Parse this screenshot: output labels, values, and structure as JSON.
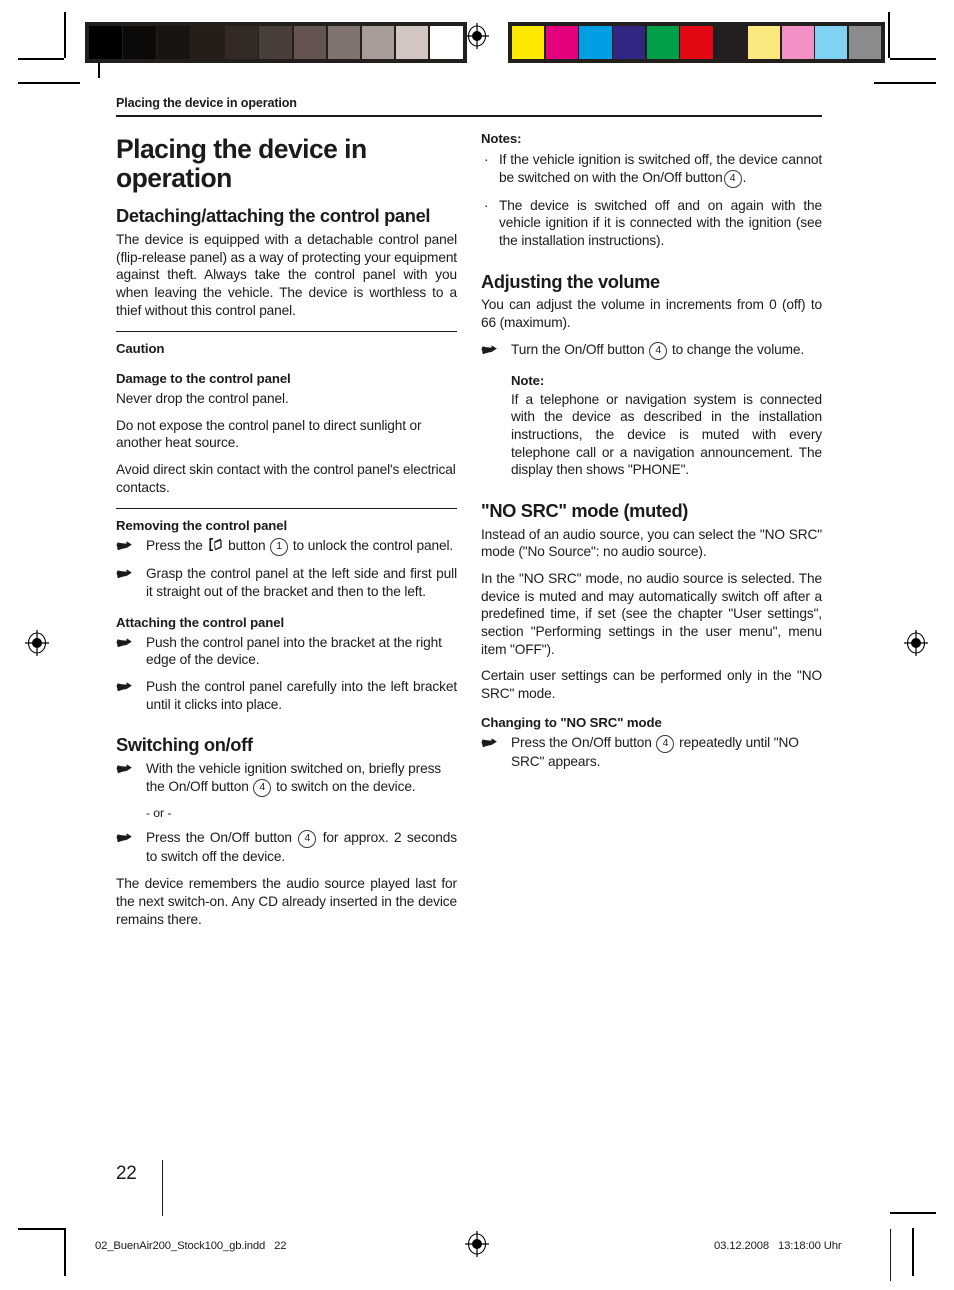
{
  "page": {
    "running_head": "Placing the device in operation",
    "page_number": "22"
  },
  "prepress": {
    "gray_bar_name": "grayscale-calibration-bar",
    "color_bar_name": "color-calibration-bar",
    "gray_swatches": [
      "#000000",
      "#0c0a08",
      "#19140f",
      "#241d18",
      "#332925",
      "#4a3e3a",
      "#635450",
      "#81736e",
      "#a89c98",
      "#d1c6c2",
      "#ffffff"
    ],
    "color_swatches": [
      "#fde900",
      "#e5007d",
      "#009ee3",
      "#312783",
      "#00a04b",
      "#e30613",
      "#231f20",
      "#fbe87f",
      "#f28fc4",
      "#7fd2f2",
      "#8d8c8c"
    ]
  },
  "main": {
    "title": "Placing the device in operation",
    "left": {
      "s1_heading": "Detaching/attaching the control panel",
      "s1_p1": "The device is equipped with a detachable control panel (flip-release panel) as a way of protecting your equipment against theft. Always take the control panel with you when leaving the vehicle. The device is worthless to a thief without this control panel.",
      "caution_heading": "Caution",
      "caution_sub": "Damage to the control panel",
      "caution_p1": "Never drop the control panel.",
      "caution_p2": "Do not expose the control panel to direct sunlight or another heat source.",
      "caution_p3": "Avoid direct skin contact with the control panel's electrical contacts.",
      "removing_heading": "Removing the control panel",
      "removing_item1_a": "Press the",
      "removing_item1_b": "button",
      "removing_item1_num": "1",
      "removing_item1_c": "to unlock the control panel.",
      "removing_item2": "Grasp the control panel at the left side and first pull it straight out of the bracket and then to the left.",
      "attaching_heading": "Attaching the control panel",
      "attaching_item1": "Push the control panel into the bracket at the right edge of the device.",
      "attaching_item2": "Push the control panel carefully into the left bracket until it clicks into place.",
      "switching_heading": "Switching on/off",
      "switching_item1_a": "With the vehicle ignition switched on, briefly press the On/Off button",
      "switching_item1_num": "4",
      "switching_item1_b": "to switch on the device.",
      "or_text": "- or -",
      "switching_item2_a": "Press the On/Off button",
      "switching_item2_num": "4",
      "switching_item2_b": "for approx. 2 seconds to switch off the device.",
      "switching_p1": "The device remembers the audio source played last for the next switch-on. Any CD already inserted in the device remains there."
    },
    "right": {
      "notes_heading": "Notes:",
      "note1_a": "If the vehicle ignition is switched off, the device cannot be switched on with the On/Off button",
      "note1_num": "4",
      "note1_b": ".",
      "note2": "The device is switched off and on again with the vehicle ignition if it is connected with the ignition (see the installation instructions).",
      "volume_heading": "Adjusting the volume",
      "volume_p1": "You can adjust the volume in increments from 0 (off) to 66 (maximum).",
      "volume_item1_a": "Turn the On/Off button",
      "volume_item1_num": "4",
      "volume_item1_b": "to change the volume.",
      "note_heading": "Note:",
      "note_p1": "If a telephone or navigation system is connected with the device as described in the installation instructions, the device is muted with every telephone call or a navigation announcement. The display then shows \"PHONE\".",
      "nosrc_heading": "\"NO SRC\" mode (muted)",
      "nosrc_p1": "Instead of an audio source, you can select the \"NO SRC\" mode (\"No Source\": no audio source).",
      "nosrc_p2": "In the \"NO SRC\" mode, no audio source is selected. The device is muted and may automatically switch off after a predefined time, if set (see the chapter \"User settings\", section \"Performing settings in the user menu\", menu item \"OFF\").",
      "nosrc_p3": "Certain user settings can be performed only in the \"NO SRC\" mode.",
      "changing_heading": "Changing to \"NO SRC\" mode",
      "changing_item1_a": "Press the On/Off button",
      "changing_item1_num": "4",
      "changing_item1_b": "repeatedly until \"NO SRC\" appears."
    }
  },
  "footer": {
    "file_label": "02_BuenAir200_Stock100_gb.indd   22",
    "timestamp": "03.12.2008   13:18:00 Uhr"
  }
}
